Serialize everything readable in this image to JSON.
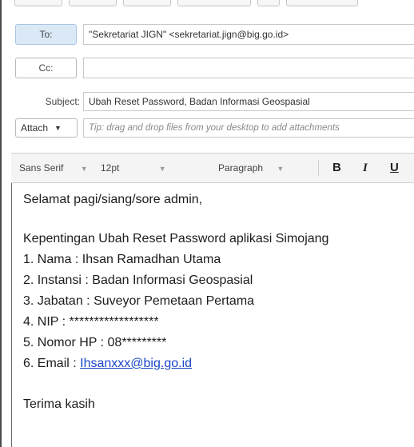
{
  "recipients": {
    "to_label": "To:",
    "to_value": "\"Sekretariat JIGN\" <sekretariat.jign@big.go.id>",
    "cc_label": "Cc:",
    "cc_value": ""
  },
  "subject": {
    "label": "Subject:",
    "value": "Ubah Reset Password, Badan Informasi Geospasial"
  },
  "attach": {
    "label": "Attach",
    "hint": "Tip: drag and drop files from your desktop to add attachments"
  },
  "format_bar": {
    "font": "Sans Serif",
    "size": "12pt",
    "block": "Paragraph",
    "bold": "B",
    "italic": "I",
    "underline": "U"
  },
  "body": {
    "greeting": "Selamat pagi/siang/sore admin,",
    "intro": "Kepentingan Ubah Reset Password aplikasi Simojang",
    "item1": "1. Nama : Ihsan Ramadhan Utama",
    "item2": "2. Instansi : Badan Informasi Geospasial",
    "item3": "3. Jabatan : Suveyor Pemetaan Pertama",
    "item4": "4. NIP : ******************",
    "item5": "5. Nomor HP : 08*********",
    "item6_prefix": "6. Email : ",
    "item6_email": "Ihsanxxx@big.go.id",
    "closing": "Terima kasih"
  }
}
